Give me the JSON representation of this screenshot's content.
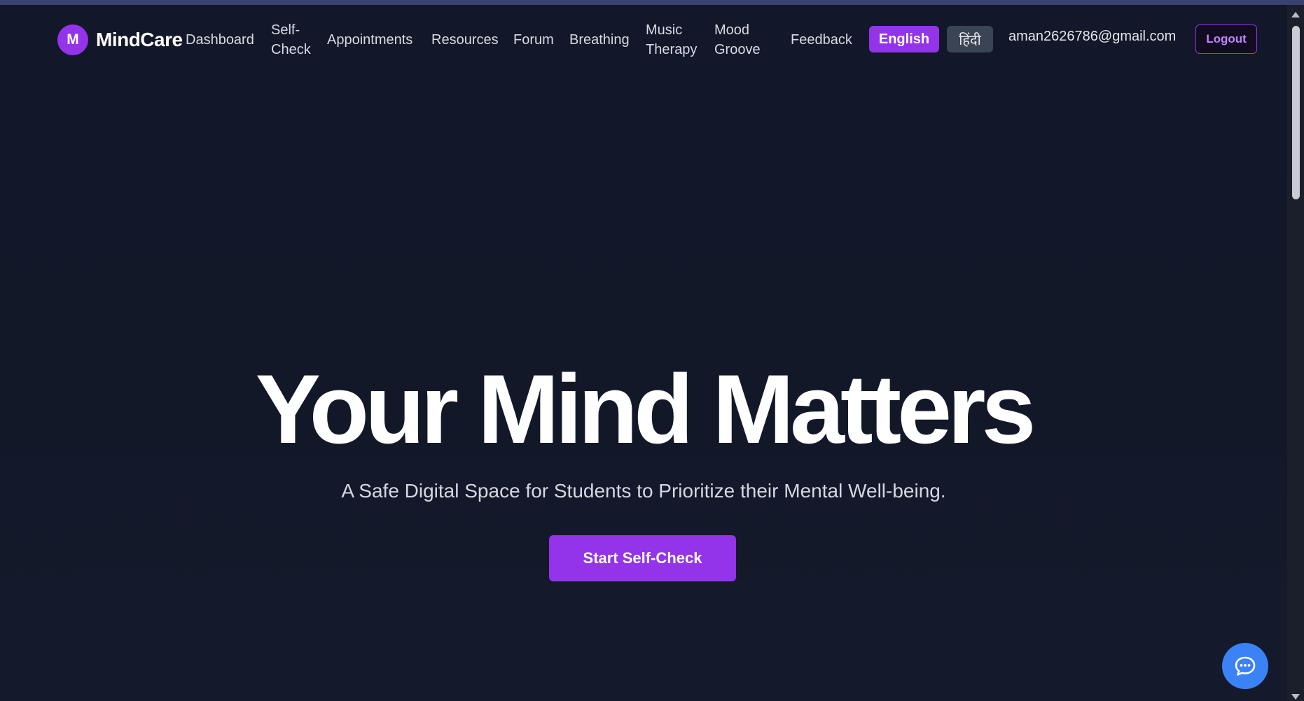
{
  "brand": {
    "mark": "M",
    "name": "MindCare"
  },
  "nav": {
    "dashboard": "Dashboard",
    "self_check_line1": "Self-",
    "self_check_line2": "Check",
    "appointments": "Appointments",
    "resources": "Resources",
    "forum": "Forum",
    "breathing": "Breathing",
    "music_line1": "Music",
    "music_line2": "Therapy",
    "mood_line1": "Mood",
    "mood_line2": "Groove",
    "feedback": "Feedback"
  },
  "language": {
    "english": "English",
    "hindi": "हिंदी",
    "selected": "English"
  },
  "user": {
    "email": "aman2626786@gmail.com",
    "logout_label": "Logout"
  },
  "hero": {
    "title": "Your Mind Matters",
    "subtitle": "A Safe Digital Space for Students to Prioritize their Mental Well-being.",
    "cta_label": "Start Self-Check"
  },
  "icons": {
    "chat": "chat-bubble-icon"
  },
  "colors": {
    "background": "#121729",
    "accent": "#9333ea",
    "chat_button": "#3b82f6",
    "hindi_button": "#3b4454"
  }
}
